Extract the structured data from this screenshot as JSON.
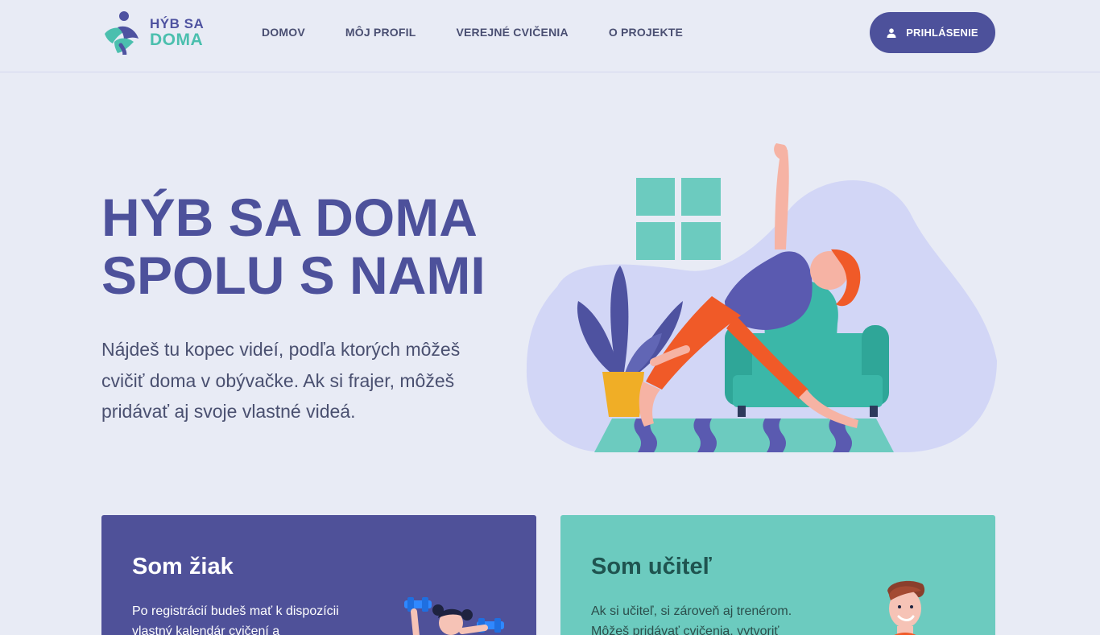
{
  "logo": {
    "line1": "HÝB SA",
    "line2": "DOMA"
  },
  "nav": [
    {
      "label": "DOMOV"
    },
    {
      "label": "MÔJ PROFIL"
    },
    {
      "label": "VEREJNÉ CVIČENIA"
    },
    {
      "label": "O PROJEKTE"
    }
  ],
  "login": {
    "label": "PRIHLÁSENIE"
  },
  "hero": {
    "title_line1": "HÝB SA DOMA",
    "title_line2": "SPOLU S NAMI",
    "subtitle": "Nájdeš tu kopec videí, podľa ktorých môžeš cvičiť doma v obývačke. Ak si frajer, môžeš pridávať aj svoje vlastné videá."
  },
  "cards": [
    {
      "title": "Som žiak",
      "text": "Po registrácií budeš mať k dispozícii vlastný kalendár cvičení a"
    },
    {
      "title": "Som učiteľ",
      "text": "Ak si učiteľ, si zároveň aj trenérom. Môžeš pridávať cvičenia, vytvoriť svoju"
    }
  ],
  "colors": {
    "background": "#e8ebf5",
    "primary": "#4d519b",
    "accent": "#6ccbbf"
  },
  "icons": [
    "user-icon"
  ]
}
